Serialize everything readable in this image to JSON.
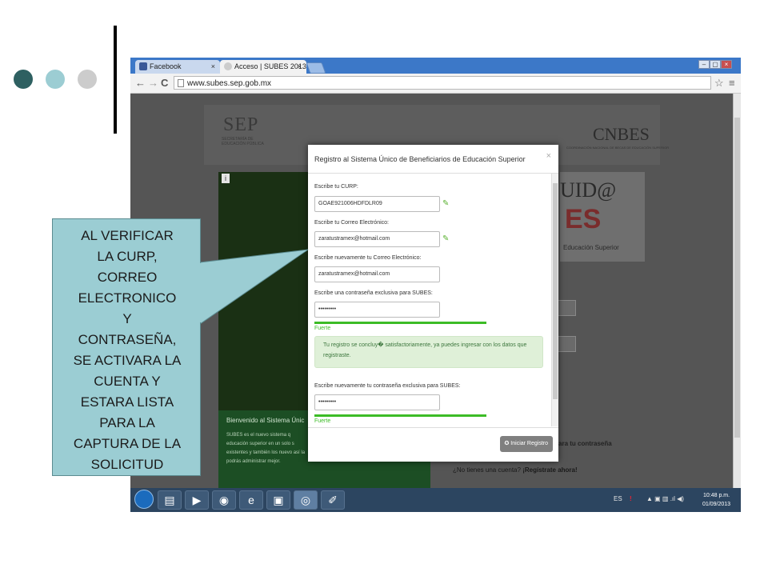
{
  "decor": {
    "dot_colors": [
      "#2e6061",
      "#9ccdd3",
      "#cccccc"
    ]
  },
  "browser": {
    "tabs": [
      {
        "label": "Facebook",
        "close": "×",
        "favicon_color": "#3b5998"
      },
      {
        "label": "Acceso | SUBES 2013",
        "close": "×",
        "favicon_color": "#cccccc"
      }
    ],
    "window_controls": [
      "–",
      "▢",
      "×"
    ],
    "nav": {
      "back": "←",
      "forward": "→",
      "reload": "C"
    },
    "url": "www.subes.sep.gob.mx",
    "star": "☆",
    "menu": "≡"
  },
  "site": {
    "sep_logo": "SEP",
    "sep_subtitle": "SECRETARÍA DE EDUCACIÓN PÚBLICA",
    "cnbes_logo": "CNBES",
    "cnbes_subtitle": "COORDINACIÓN NACIONAL DE BECAS DE EDUCACIÓN SUPERIOR",
    "uid_logo": "UID@",
    "es_logo": "ES",
    "edu_label": "Educación Superior",
    "side_label": "i",
    "welcome_title": "Bienvenido al Sistema Únic",
    "welcome_text": "SUBES es el nuevo sistema q educación superior en un solo s existentes y también los nuevo así la podrás administrar mejor.",
    "forgot_password_tail": "ara tu contraseña",
    "register_prompt": "¿No tienes una cuenta?",
    "register_link": "¡Regístrate ahora!"
  },
  "modal": {
    "title": "Registro al Sistema Único de Beneficiarios de Educación Superior",
    "close": "×",
    "fields": {
      "curp_label": "Escribe tu CURP:",
      "curp_value": "GOAE921006HDFDLR09",
      "email_label": "Escribe tu Correo Electrónico:",
      "email_value": "zaratustramex@hotmail.com",
      "email2_label": "Escribe nuevamente tu Correo Electrónico:",
      "email2_value": "zaratustramex@hotmail.com",
      "pass_label": "Escribe una contraseña exclusiva para SUBES:",
      "pass_value": "•••••••••",
      "pass_strength": "Fuerte",
      "success_message": "Tu registro se concluy� satisfactoriamente, ya puedes ingresar con los datos que registraste.",
      "pass2_label": "Escribe nuevamente tu contraseña exclusiva para SUBES:",
      "pass2_value": "•••••••••",
      "pass2_strength": "Fuerte"
    },
    "check_icon": "✎",
    "submit": "✪ Iniciar Registro"
  },
  "taskbar": {
    "buttons": [
      "▤",
      "▶",
      "◉",
      "e",
      "▣",
      "◎",
      "✐"
    ],
    "lang": "ES",
    "tray_icons": "▲ ▣ ▥ .ıl ◀)",
    "time": "10:48 p.m.",
    "date": "01/09/2013"
  },
  "callout": {
    "text": "AL VERIFICAR\nLA CURP,\nCORREO\nELECTRONICO\nY\nCONTRASEÑA,\nSE ACTIVARA LA\nCUENTA Y\nESTARA LISTA\nPARA LA\nCAPTURA DE LA\nSOLICITUD"
  }
}
